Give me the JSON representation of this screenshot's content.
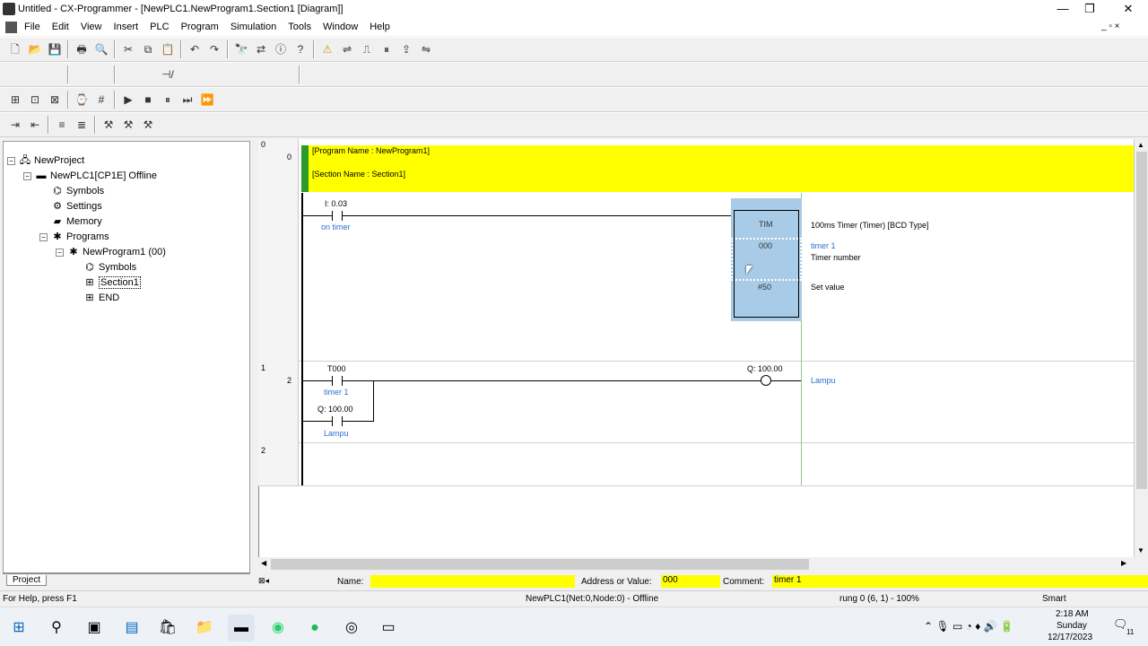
{
  "window": {
    "title": "Untitled - CX-Programmer - [NewPLC1.NewProgram1.Section1 [Diagram]]",
    "minimize": "—",
    "restore": "❐",
    "close": "✕"
  },
  "menu": [
    "File",
    "Edit",
    "View",
    "Insert",
    "PLC",
    "Program",
    "Simulation",
    "Tools",
    "Window",
    "Help"
  ],
  "project_tree": {
    "tab": "Project",
    "nodes": [
      "NewProject",
      "NewPLC1[CP1E] Offline",
      "Symbols",
      "Settings",
      "Memory",
      "Programs",
      "NewProgram1 (00)",
      "Symbols",
      "Section1",
      "END"
    ]
  },
  "diagram": {
    "header": {
      "program_name": "[Program Name : NewProgram1]",
      "section_name": "[Section Name : Section1]",
      "rung_no": "0",
      "step": "0"
    },
    "rung0": {
      "rung_no": "0",
      "step": "",
      "contact_addr": "I: 0.03",
      "contact_comment": "on timer",
      "tim_label": "TIM",
      "tim_number": "000",
      "tim_set": "#50",
      "desc_title": "100ms Timer (Timer) [BCD Type]",
      "desc_comment": "timer 1",
      "desc_number": "Timer number",
      "desc_set": "Set value"
    },
    "rung1": {
      "rung_no": "1",
      "step": "2",
      "contact1_addr": "T000",
      "contact1_comment": "timer 1",
      "contact2_addr": "Q: 100.00",
      "contact2_comment": "Lampu",
      "coil_addr": "Q: 100.00",
      "coil_comment": "Lampu"
    },
    "rung2": {
      "rung_no": "2"
    }
  },
  "propbar": {
    "name_label": "Name:",
    "name_value": "",
    "addr_label": "Address or Value:",
    "addr_value": "000",
    "comment_label": "Comment:",
    "comment_value": "timer 1"
  },
  "status": {
    "help": "For Help, press F1",
    "plc": "NewPLC1(Net:0,Node:0) - Offline",
    "rung": "rung 0 (6, 1) - 100%",
    "mode": "Smart"
  },
  "taskbar": {
    "time": "2:18 AM",
    "day": "Sunday",
    "date": "12/17/2023",
    "notif": "11"
  }
}
